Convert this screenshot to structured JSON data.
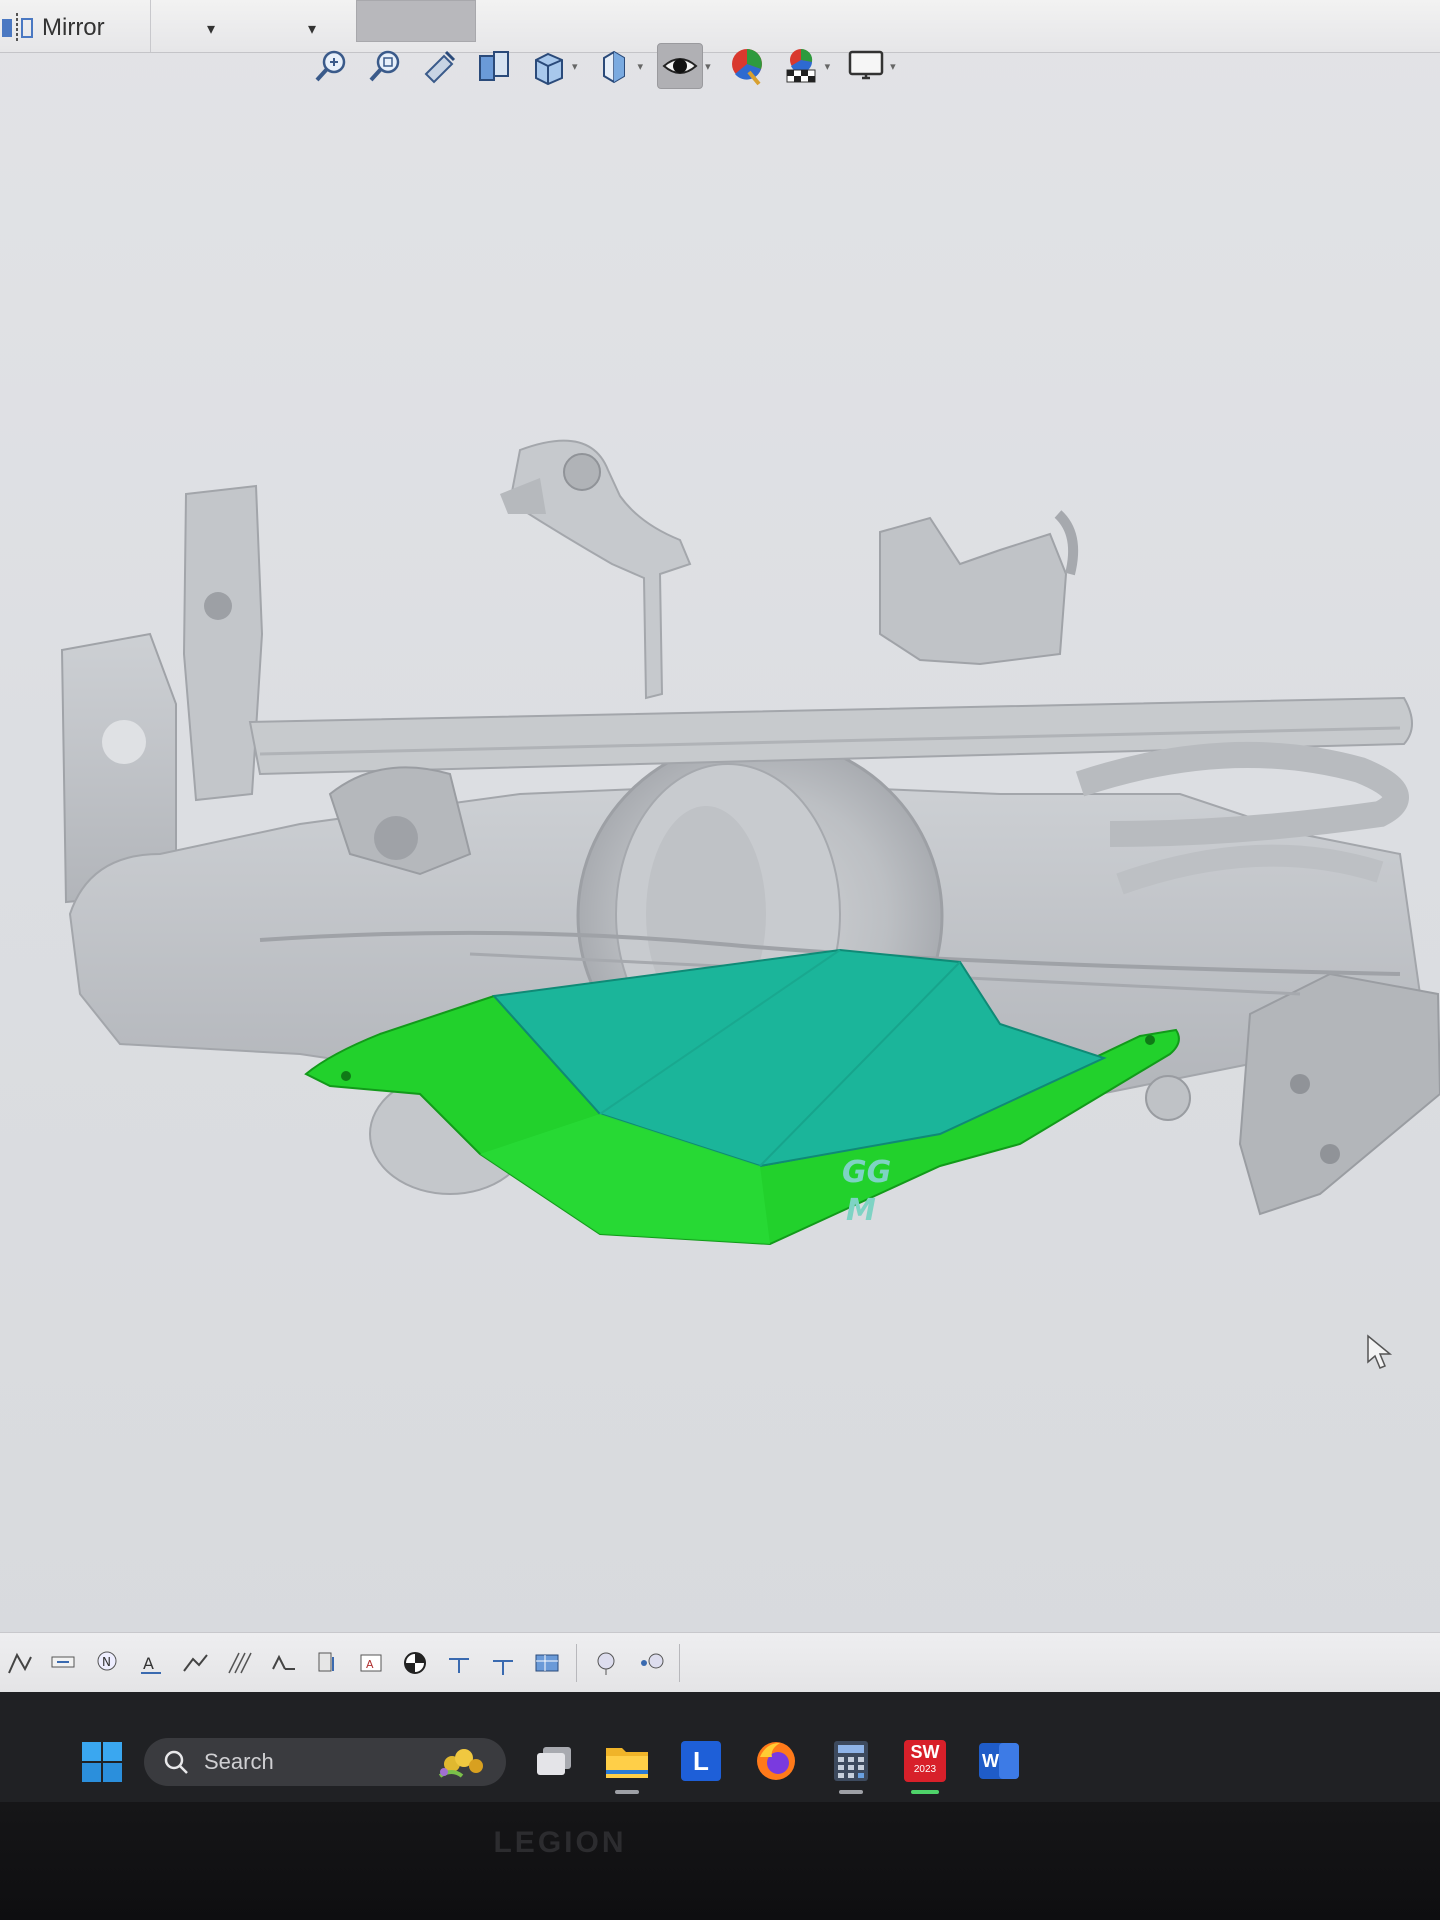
{
  "command_manager": {
    "mirror_label": "Mirror"
  },
  "view_toolbar": {
    "tools": [
      {
        "name": "zoom-to-fit-icon"
      },
      {
        "name": "zoom-to-area-icon"
      },
      {
        "name": "previous-view-icon"
      },
      {
        "name": "section-view-icon"
      },
      {
        "name": "view-orientation-icon"
      },
      {
        "name": "display-style-icon"
      },
      {
        "name": "hide-show-items-icon",
        "active": true
      },
      {
        "name": "edit-appearance-icon"
      },
      {
        "name": "apply-scene-icon"
      },
      {
        "name": "view-settings-icon"
      }
    ]
  },
  "model": {
    "part_engraving": [
      "GG",
      "M"
    ],
    "colors": {
      "scan_mesh": "#c4c6ca",
      "skid_plate_outer": "#22d12c",
      "skid_plate_inner": "#1bb59a"
    }
  },
  "taskbar": {
    "search_placeholder": "Search",
    "apps": [
      {
        "name": "task-view-icon"
      },
      {
        "name": "file-explorer-icon"
      },
      {
        "name": "l-app-icon",
        "letter": "L"
      },
      {
        "name": "firefox-icon"
      },
      {
        "name": "calculator-icon"
      },
      {
        "name": "solidworks-icon",
        "letter": "SW",
        "badge": "2023",
        "active": true
      },
      {
        "name": "word-icon",
        "letter": "W"
      }
    ]
  },
  "laptop": {
    "brand": "LEGION"
  }
}
